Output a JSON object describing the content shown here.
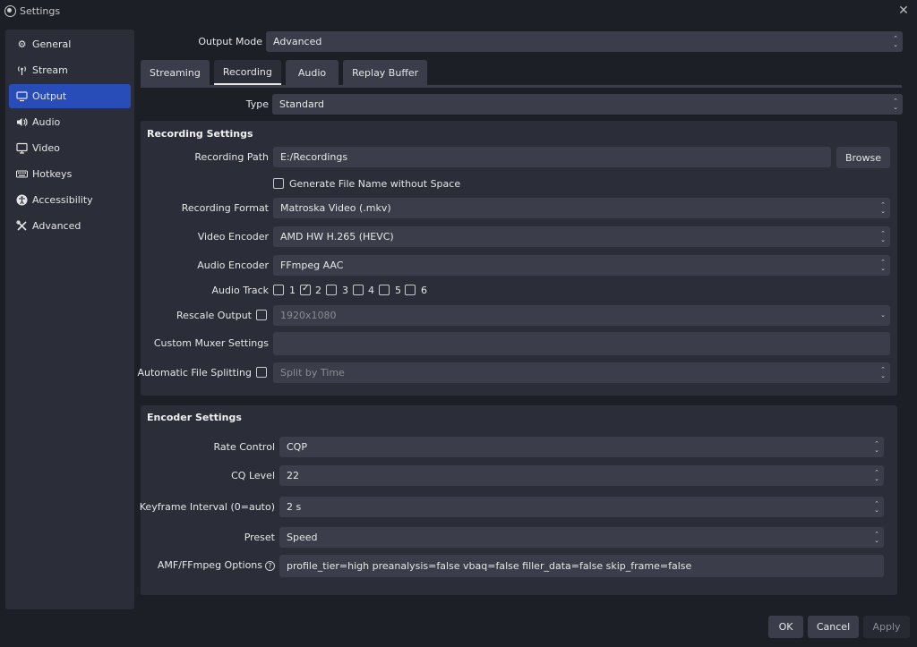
{
  "window": {
    "title": "Settings"
  },
  "sidebar": {
    "items": [
      {
        "label": "General",
        "icon": "gear-icon"
      },
      {
        "label": "Stream",
        "icon": "antenna-icon"
      },
      {
        "label": "Output",
        "icon": "monitor-output-icon"
      },
      {
        "label": "Audio",
        "icon": "speaker-icon"
      },
      {
        "label": "Video",
        "icon": "display-icon"
      },
      {
        "label": "Hotkeys",
        "icon": "keyboard-icon"
      },
      {
        "label": "Accessibility",
        "icon": "accessibility-icon"
      },
      {
        "label": "Advanced",
        "icon": "wrench-icon"
      }
    ],
    "active": "Output"
  },
  "output_mode": {
    "label": "Output Mode",
    "value": "Advanced"
  },
  "tabs": [
    "Streaming",
    "Recording",
    "Audio",
    "Replay Buffer"
  ],
  "active_tab": "Recording",
  "type": {
    "label": "Type",
    "value": "Standard"
  },
  "recording": {
    "title": "Recording Settings",
    "path_label": "Recording Path",
    "path_value": "E:/Recordings",
    "browse": "Browse",
    "gen_name_label": "Generate File Name without Space",
    "format_label": "Recording Format",
    "format_value": "Matroska Video (.mkv)",
    "video_encoder_label": "Video Encoder",
    "video_encoder_value": "AMD HW H.265 (HEVC)",
    "audio_encoder_label": "Audio Encoder",
    "audio_encoder_value": "FFmpeg AAC",
    "audio_track_label": "Audio Track",
    "tracks": [
      "1",
      "2",
      "3",
      "4",
      "5",
      "6"
    ],
    "tracks_checked": [
      false,
      true,
      false,
      false,
      false,
      false
    ],
    "rescale_label": "Rescale Output",
    "rescale_value": "1920x1080",
    "muxer_label": "Custom Muxer Settings",
    "muxer_value": "",
    "split_label": "Automatic File Splitting",
    "split_value": "Split by Time"
  },
  "encoder": {
    "title": "Encoder Settings",
    "rate_label": "Rate Control",
    "rate_value": "CQP",
    "cq_label": "CQ Level",
    "cq_value": "22",
    "keyframe_label": "Keyframe Interval (0=auto)",
    "keyframe_value": "2 s",
    "preset_label": "Preset",
    "preset_value": "Speed",
    "amf_label": "AMF/FFmpeg Options",
    "amf_value": "profile_tier=high preanalysis=false vbaq=false filler_data=false skip_frame=false"
  },
  "buttons": {
    "ok": "OK",
    "cancel": "Cancel",
    "apply": "Apply"
  }
}
